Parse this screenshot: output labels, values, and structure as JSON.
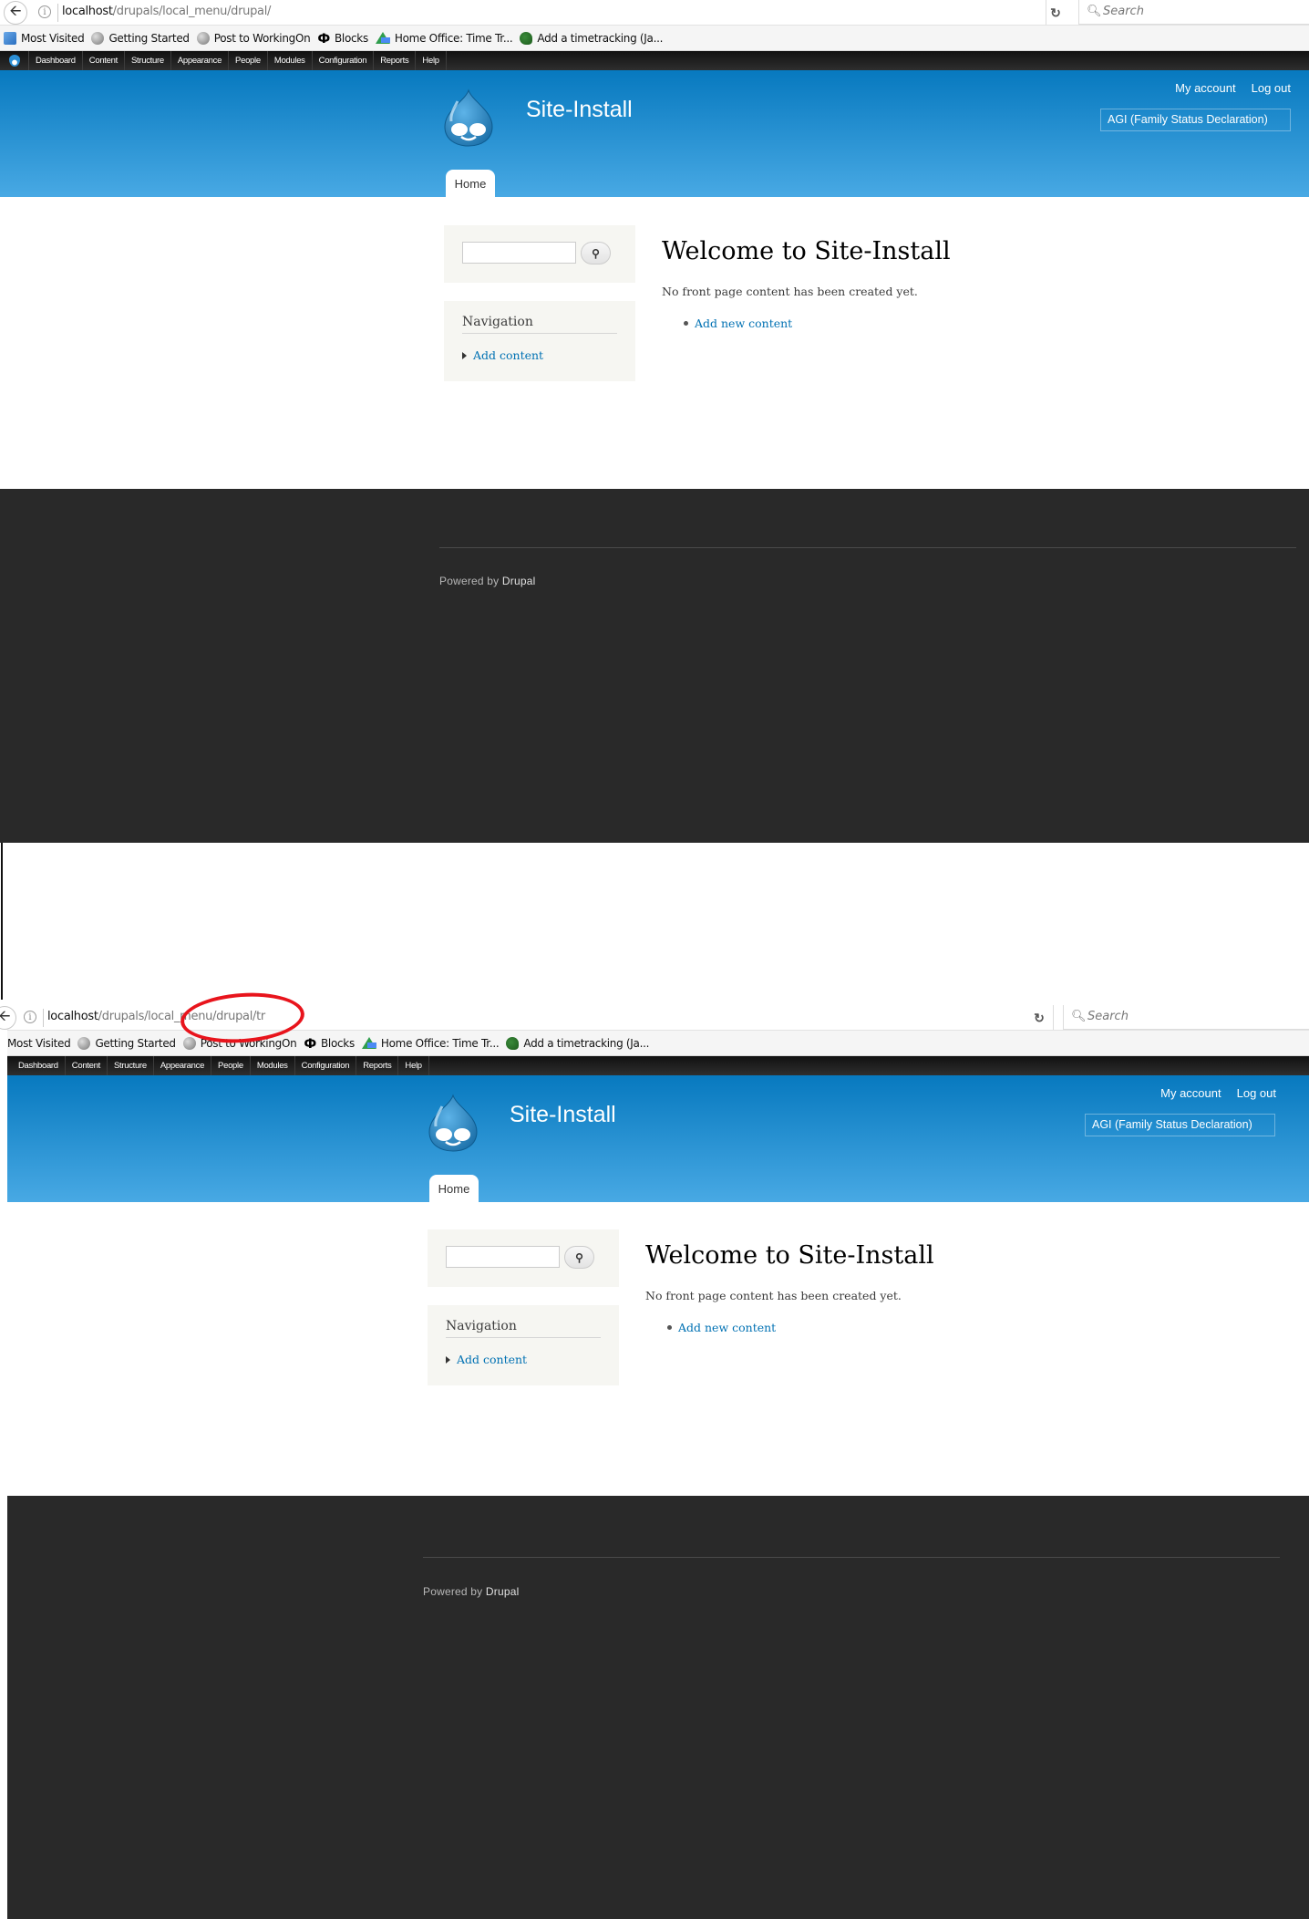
{
  "screenshots": [
    {
      "browser": {
        "url_host": "localhost",
        "url_path": "/drupals/local_menu/drupal/",
        "search_placeholder": "Search",
        "bookmarks": [
          {
            "label": "Most Visited",
            "icon": "most-visited-icon"
          },
          {
            "label": "Getting Started",
            "icon": "globe-icon"
          },
          {
            "label": "Post to WorkingOn",
            "icon": "globe-icon"
          },
          {
            "label": "Blocks",
            "icon": "blocks-icon"
          },
          {
            "label": "Home Office: Time Tr...",
            "icon": "google-drive-icon"
          },
          {
            "label": "Add a timetracking (Ja...",
            "icon": "duck-icon"
          }
        ]
      }
    },
    {
      "browser": {
        "url_host": "localhost",
        "url_path": "/drupals/local_menu/drupal/tr",
        "search_placeholder": "Search",
        "bookmarks": [
          {
            "label": "Most Visited",
            "icon": "most-visited-icon"
          },
          {
            "label": "Getting Started",
            "icon": "globe-icon"
          },
          {
            "label": "Post to WorkingOn",
            "icon": "globe-icon"
          },
          {
            "label": "Blocks",
            "icon": "blocks-icon"
          },
          {
            "label": "Home Office: Time Tr...",
            "icon": "google-drive-icon"
          },
          {
            "label": "Add a timetracking (Ja...",
            "icon": "duck-icon"
          }
        ]
      },
      "annotation": "red-ellipse-highlight"
    }
  ],
  "admin_toolbar": {
    "items": [
      "Dashboard",
      "Content",
      "Structure",
      "Appearance",
      "People",
      "Modules",
      "Configuration",
      "Reports",
      "Help"
    ]
  },
  "site": {
    "name": "Site-Install",
    "secondary_menu": [
      "My account",
      "Log out"
    ],
    "selector_value": "AGI (Family Status Declaration)",
    "main_menu": [
      "Home"
    ],
    "colors": {
      "header_top": "#0779bf",
      "header_bottom": "#48a9e4",
      "link": "#0071b3",
      "footer": "#292929",
      "annotation": "#e8141c"
    }
  },
  "sidebar": {
    "search_button_icon": "search-icon",
    "navigation_title": "Navigation",
    "navigation_items": [
      "Add content"
    ]
  },
  "main": {
    "title": "Welcome to Site-Install",
    "message": "No front page content has been created yet.",
    "links": [
      "Add new content"
    ]
  },
  "footer": {
    "powered_by_prefix": "Powered by ",
    "powered_by_link": "Drupal"
  }
}
